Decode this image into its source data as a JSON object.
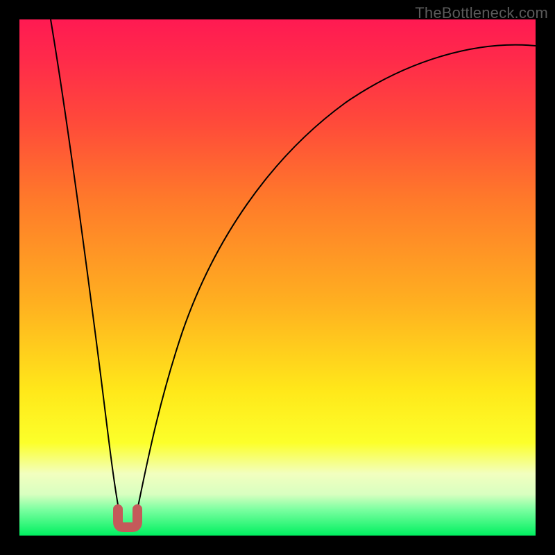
{
  "watermark": "TheBottleneck.com",
  "chart_data": {
    "type": "line",
    "title": "",
    "xlabel": "",
    "ylabel": "",
    "xlim": [
      0,
      100
    ],
    "ylim": [
      0,
      100
    ],
    "grid": false,
    "legend": false,
    "gradient_meaning": "vertical position maps to bottleneck severity; green (bottom) = low, red (top) = high",
    "series": [
      {
        "name": "bottleneck-curve",
        "x": [
          6,
          8,
          10,
          12,
          14,
          16,
          18,
          19,
          20,
          21,
          22,
          24,
          26,
          30,
          35,
          40,
          50,
          60,
          70,
          80,
          90,
          100
        ],
        "y": [
          100,
          88,
          76,
          62,
          48,
          34,
          18,
          8,
          2,
          2,
          8,
          20,
          31,
          47,
          60,
          68,
          78,
          84,
          88,
          91,
          93,
          95
        ]
      }
    ],
    "marker": {
      "name": "optimal-range",
      "shape": "u",
      "x_range": [
        19,
        22
      ],
      "y": 2,
      "color": "#c45a5a"
    }
  }
}
